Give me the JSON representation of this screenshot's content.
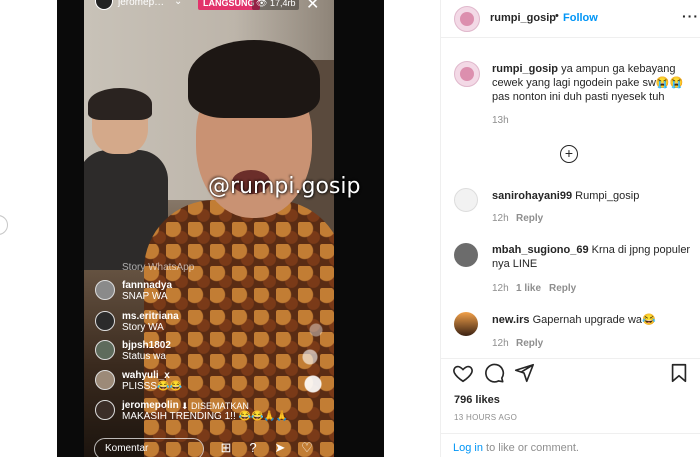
{
  "live": {
    "username": "jeromep…",
    "badge": "LANGSUNG",
    "viewers": "17,4rb",
    "watermark": "@rumpi.gosip",
    "comments": [
      {
        "name": "",
        "text": "Story WhatsApp",
        "faded": true
      },
      {
        "name": "fannnadya",
        "text": "SNAP WA"
      },
      {
        "name": "ms.eritriana",
        "text": "Story WA"
      },
      {
        "name": "bjpsh1802",
        "text": "Status wa"
      },
      {
        "name": "wahyuli_x",
        "text": "PLISSS😂😂"
      }
    ],
    "pinned": {
      "name": "jeromepolin",
      "tag": "⬇ DISEMATKAN",
      "text": "MAKASIH TRENDING 1!! 😂😂🙏🙏"
    },
    "comment_placeholder": "Komentar"
  },
  "post": {
    "author": "rumpi_gosip",
    "follow_label": "Follow",
    "more": "···",
    "caption_user": "rumpi_gosip",
    "caption_text": "ya ampun ga kebayang cewek yang lagi ngodein pake sw😭😭 pas nonton ini duh pasti nyesek tuh",
    "caption_time": "13h",
    "comments": [
      {
        "user": "sanirohayani99",
        "text": "Rumpi_gosip",
        "time": "12h",
        "likes": "",
        "reply": "Reply"
      },
      {
        "user": "mbah_sugiono_69",
        "text": "Krna di jpng populer nya LINE",
        "time": "12h",
        "likes": "1 like",
        "reply": "Reply"
      },
      {
        "user": "new.irs",
        "text": "Gapernah upgrade wa😂",
        "time": "12h",
        "likes": "",
        "reply": "Reply"
      }
    ],
    "likes": "796 likes",
    "timestamp": "13 HOURS AGO",
    "login_link": "Log in",
    "login_rest": " to like or comment."
  },
  "icons": [
    "heart-icon",
    "comment-icon",
    "share-icon",
    "bookmark-icon",
    "add-circle-icon"
  ],
  "colors": {
    "accent": "#0095f6",
    "live": "#e2336b"
  }
}
